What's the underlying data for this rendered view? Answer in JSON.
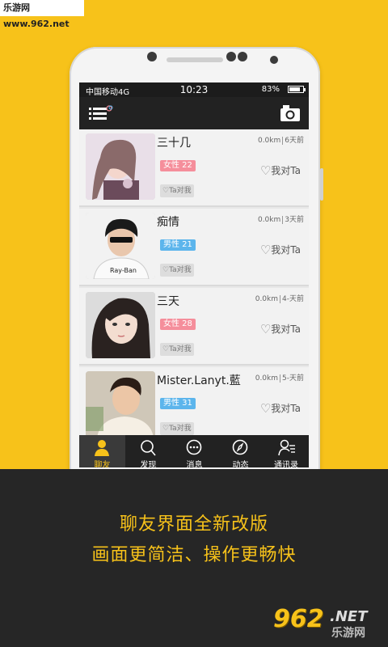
{
  "watermark": {
    "top_left": "乐游网 www.962.net"
  },
  "status_bar": {
    "carrier": "中国移动4G",
    "time": "10:23",
    "battery_pct": "83%",
    "battery_level": 0.83
  },
  "app_bar": {
    "menu_icon": "menu-list-icon",
    "camera_icon": "camera-icon"
  },
  "users": [
    {
      "name": "三十几",
      "gender": "女性 22",
      "gender_type": "female",
      "distance": "0.0km",
      "time": "6天前",
      "like": "我对Ta",
      "ta_dui_wo": "Ta对我"
    },
    {
      "name": "痴情",
      "gender": "男性 21",
      "gender_type": "male",
      "distance": "0.0km",
      "time": "3天前",
      "like": "我对Ta",
      "ta_dui_wo": "Ta对我"
    },
    {
      "name": "三天",
      "gender": "女性 28",
      "gender_type": "female",
      "distance": "0.0km",
      "time": "4-天前",
      "like": "我对Ta",
      "ta_dui_wo": "Ta对我"
    },
    {
      "name": "Mister.Lanyt.藍",
      "gender": "男性 31",
      "gender_type": "male",
      "distance": "0.0km",
      "time": "5-天前",
      "like": "我对Ta",
      "ta_dui_wo": "Ta对我"
    }
  ],
  "tabs": [
    {
      "label": "聊友",
      "icon": "person-icon",
      "active": true
    },
    {
      "label": "发现",
      "icon": "search-icon",
      "active": false
    },
    {
      "label": "消息",
      "icon": "chat-bubble-icon",
      "active": false
    },
    {
      "label": "动态",
      "icon": "compass-icon",
      "active": false
    },
    {
      "label": "通讯录",
      "icon": "contacts-icon",
      "active": false
    }
  ],
  "banner": {
    "line1": "聊友界面全新改版",
    "line2": "画面更简洁、操作更畅快"
  },
  "logo": {
    "number": "962",
    "net": ".NET",
    "cn": "乐游网"
  },
  "colors": {
    "accent": "#f7c21a",
    "dark": "#222222",
    "female": "#f58e9b",
    "male": "#5cb5ec"
  }
}
